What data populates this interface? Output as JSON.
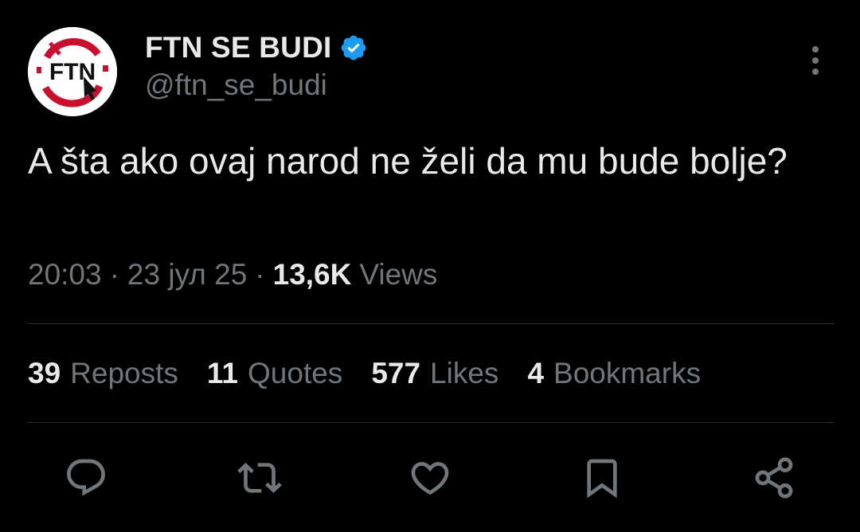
{
  "author": {
    "display_name": "FTN SE BUDI",
    "handle": "@ftn_se_budi",
    "avatar_icon": "ftn-logo-icon",
    "avatar_text": "FTN",
    "verified_icon": "verified-badge-icon",
    "verified_color": "#1d9bf0"
  },
  "tweet": {
    "text": "A šta ako ovaj narod ne želi da mu bude bolje?",
    "time": "20:03",
    "date": "23 јул 25",
    "separator": "·",
    "views_count": "13,6K",
    "views_label": "Views"
  },
  "stats": {
    "reposts_count": "39",
    "reposts_label": "Reposts",
    "quotes_count": "11",
    "quotes_label": "Quotes",
    "likes_count": "577",
    "likes_label": "Likes",
    "bookmarks_count": "4",
    "bookmarks_label": "Bookmarks"
  },
  "actions": {
    "reply_icon": "reply-icon",
    "repost_icon": "repost-icon",
    "like_icon": "heart-icon",
    "bookmark_icon": "bookmark-icon",
    "share_icon": "share-icon"
  },
  "colors": {
    "background": "#000000",
    "text_primary": "#e7e9ea",
    "text_secondary": "#71767b",
    "divider": "#2f3336",
    "logo_red": "#c8102e"
  }
}
